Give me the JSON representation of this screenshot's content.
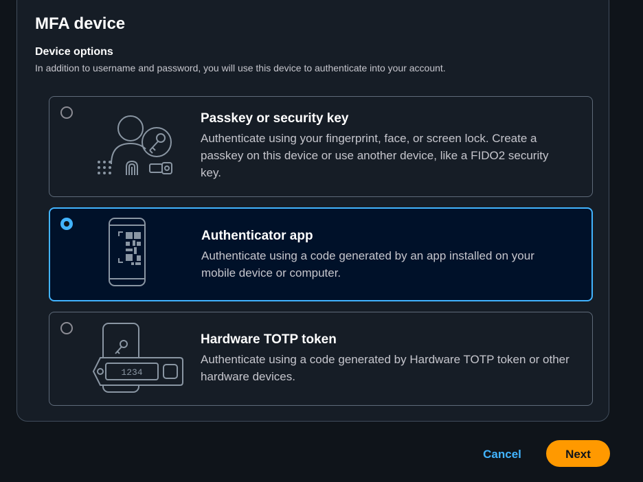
{
  "mfa": {
    "title": "MFA device",
    "section_label": "Device options",
    "section_description": "In addition to username and password, you will use this device to authenticate into your account."
  },
  "options": [
    {
      "title": "Passkey or security key",
      "description": "Authenticate using your fingerprint, face, or screen lock. Create a passkey on this device or use another device, like a FIDO2 security key.",
      "icon": "passkey-illustration-icon",
      "selected": false
    },
    {
      "title": "Authenticator app",
      "description": "Authenticate using a code generated by an app installed on your mobile device or computer.",
      "icon": "authenticator-app-illustration-icon",
      "selected": true
    },
    {
      "title": "Hardware TOTP token",
      "description": "Authenticate using a code generated by Hardware TOTP token or other hardware devices.",
      "icon": "hardware-token-illustration-icon",
      "token_display": "1234",
      "selected": false
    }
  ],
  "footer": {
    "cancel_label": "Cancel",
    "next_label": "Next"
  },
  "colors": {
    "page_bg": "#0f141a",
    "panel_bg": "#161d26",
    "accent": "#42b4ff",
    "primary_button": "#ff9900",
    "selected_bg": "#001129"
  }
}
